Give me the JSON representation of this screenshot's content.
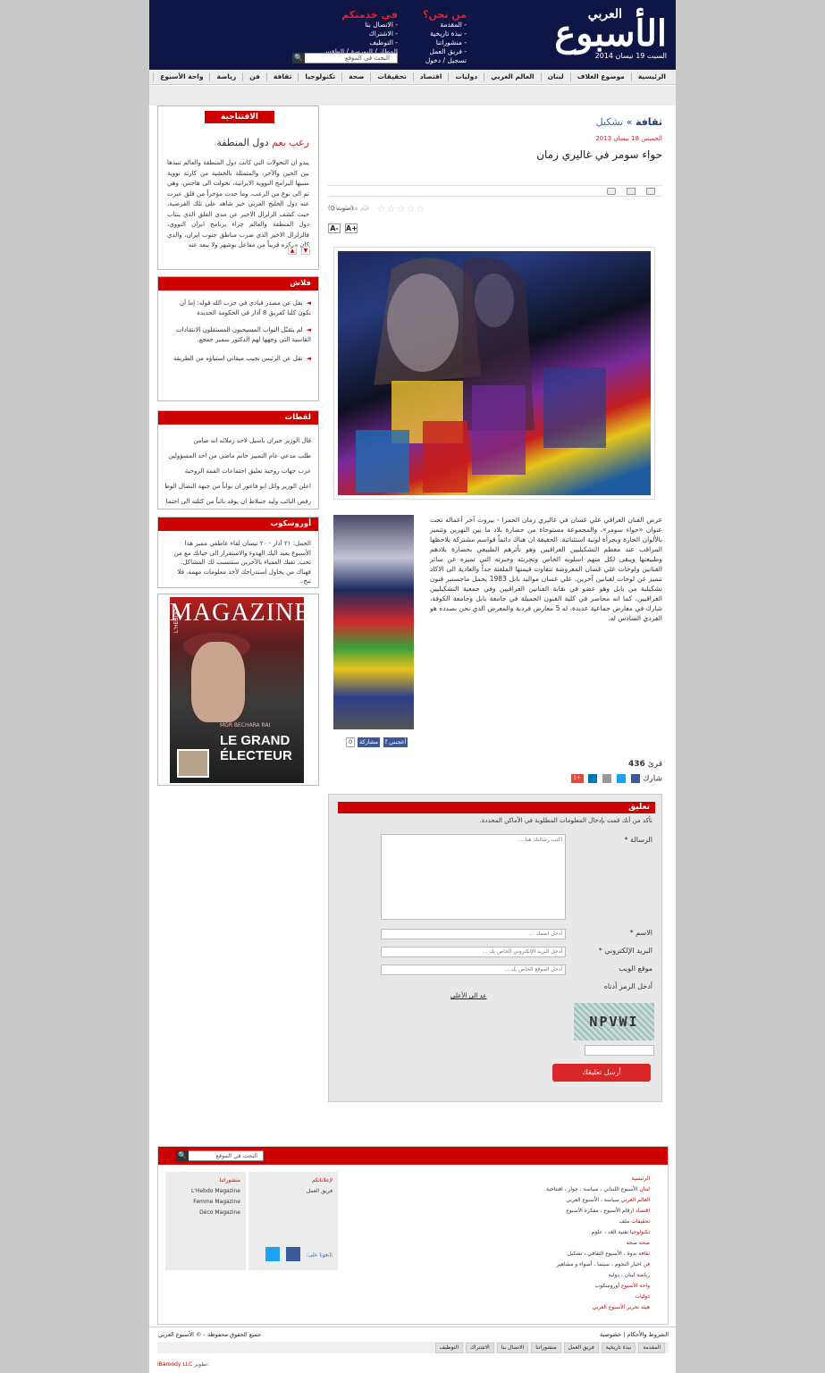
{
  "header": {
    "logo_main": "الأسبوع",
    "logo_sub": "العربي",
    "date": "السبت 19 نيسان 2014",
    "about": {
      "title": "من نحن؟",
      "links": [
        "- المقدمة",
        "- نبذة تاريخية",
        "- منشوراتنا",
        "- فريق العمل",
        "تسجيل / دخول"
      ]
    },
    "services": {
      "title": "في خدمتكم",
      "links": [
        "- الاتصال بنا",
        "- الاشتراك",
        "- التوظيف",
        "المطار / البورصة / الطقس"
      ]
    },
    "search_placeholder": "البحث في الموقع",
    "search_btn": "🔍"
  },
  "nav": [
    "الرئيسية",
    "موضوع الغلاف",
    "لبنان",
    "العالم العربي",
    "دوليات",
    "اقتصاد",
    "تحقيقات",
    "صحة",
    "تكنولوجيا",
    "ثقافة",
    "فن",
    "رياضة",
    "واحة الأسبوع"
  ],
  "article": {
    "section": "ثقافة",
    "subsection": "تشكيل",
    "date": "الخميس 18 نيسان 2013",
    "title": "حواء سومر في غاليري زمان",
    "rate_hint": "قيّم هذا المقال",
    "rate_count": "(صوت 0)",
    "stars": "☆☆☆☆☆",
    "font_plus": "A+",
    "font_minus": "A-",
    "body": "عرض الفنان العراقي علي غسان في غاليري زمان الحمرا - بيروت آخر أعماله تحت عنوان «حواء سومر»، والمجموعة مستوحاة من حضارة بلاد ما بين النهرين وتتميز بالألوان الحارة وبجرأة لونية استثنائية. الحقيقة ان هناك دائماً قواسم مشتركة يلاحظها المراقب عند معظم التشكيليين العراقيين وهو تأثرهم الطبيعي بحضارة بلادهم وطبيعتها ويبقى لكل منهم اسلوبه الخاص وتجربته وخبرته التي تميزه عن سائر الفنانين ولوحات علي غسان المعروضة تتفاوت قيمتها الملفتة جداً والعادية الى الاكاد تتميز عن لوحات لفنانين آخرين. علي غسان مواليد بابل 1983 يحمل ماجستير فنون تشكيلية من بابل وهو عضو في نقابة الفنانين العراقيين وفي جمعية التشكيليين العراقيين، كما انه محاضر في كلية الفنون الجميلة في جامعة بابل وجامعة الكوفة، شارك في معارض جماعية عديدة، له 5 معارض فردية والمعرض الذي نحن بصدده هو الفردي السادس له.",
    "fb_like": "أعجبني",
    "fb_share": "مشاركة",
    "fb_count": "0",
    "reads_label": "قرئ",
    "reads": "436",
    "share_label": "شارك",
    "gplus": "+1"
  },
  "comment": {
    "title": "تعليق",
    "note": "تأكد من أنك قمت بإدخال المعلومات المطلوبة في الأماكن المحددة.",
    "message_label": "الرسالة *",
    "message_placeholder": "اكتب رسالتك هنا ...",
    "name_label": "الاسم *",
    "name_placeholder": "أدخل اسمك ...",
    "email_label": "البريد الإلكتروني *",
    "email_placeholder": "أدخل البريد الإلكتروني الخاص بك ...",
    "site_label": "موقع الويب",
    "site_placeholder": "أدخل الموقع الخاص بك ...",
    "captcha_label": "أدخل الرمز أدناه",
    "captcha_text": "NPVWI",
    "send": "أرسل تعليقك",
    "to_top": "عد الى الأعلى"
  },
  "sidebar": {
    "editorial": {
      "title": "الافتتاحية",
      "headline_a": "رعب بعم",
      "headline_b": "دول المنطقة",
      "body": "يبدو ان التحولات التي كانت دول المنطقة والعالم تنبذها بين الحين والآخر، والمتمثلة بالخشية من كارثة نووية سببها البرامج النووية الايرانية، تحولت الى هاجس، وهي تم الى نوع من الرعب، وما حدث مؤخراً من قلق عبرت عنه دول الخليج العربي خير شاهد على تلك الفرضية، حيث كشف الزلزال الاخير عن مدى القلق الذي ينتاب دول المنطقة والعالم جراء برنامج ايران النووي، فالزلزال الاخير الذي ضرب مناطق جنوب ايران، والذي كان مركزه قريباً من مفاعل بوشهر ولا يبعد عنه",
      "up": "▲",
      "down": "▼"
    },
    "flash": {
      "title": "فلاش",
      "items": [
        "نقل عن مصدر قيادي في حزب الله قوله: إما أن نكون كلنا كفريق 8 آذار في الحكومة الجديدة",
        "لم يتقبّل النواب المسيحيون المستقلون الانتقادات القاسية التي وجهها لهم الدكتور سمير جعجع.",
        "نقل عن الرئيس نجيب ميقاتي استياؤه من الطريقة"
      ]
    },
    "snapshots": {
      "title": "لقطات",
      "items": [
        "قال الوزير جبران باسيل لاحد زملائه انه ضامن",
        "طلب مدعي عام التمييز حاتم ماضي من احد المسؤولين",
        "عرب جهات روحية تعليق اجتماعات القمة الروحية",
        "اعلن الوزير وائل ابو فاعور ان نواباً من جبهة النضال الوطني",
        "رفض النائب وليد جنبلاط ان يوقد نائباً من كتلته الى اجتماع"
      ]
    },
    "horoscope": {
      "title": "أوروسكوب",
      "body": "الحمل: ٢١ آذار - ٢٠ نيسان لقاء عاطفي مميز هذا الأسبوع يعيد اليك الهدوء والاستقرار الى حياتك مع من تحب. تفتك العمياء بالآخرين ستتسبب لك المشاكل. فهناك من يحاول استدراجك لأخذ معلومات مهمة. فلا تبح.."
    },
    "magazine": {
      "brand": "L'HEBDO",
      "title": "MAGAZINE",
      "cover": "LE GRAND ÉLECTEUR",
      "kicker": "MGR BECHARA RAI"
    }
  },
  "footer": {
    "search_placeholder": "البحث في الموقع",
    "search_btn": "🔍",
    "box_ads": {
      "title": "لإعلاناتكم",
      "items": [
        "فريق العمل"
      ]
    },
    "box_pubs": {
      "title": "منشوراتنا",
      "items": [
        "L'Hebdo Magazine",
        "Femme Magazine",
        "Déco Magazine"
      ]
    },
    "follow": "تابعونا على:",
    "sitemap": [
      {
        "head": "الرئيسية",
        "sub": ""
      },
      {
        "head": "لبنان",
        "sub": "الأسبوع اللبناني ، سياسة ، حوار ، افتتاحية"
      },
      {
        "head": "العالم العربي",
        "sub": "سياسة ، الأسبوع العربي"
      },
      {
        "head": "اقتصاد",
        "sub": "ارقام الأسبوع ، مفكرة الأسبوع"
      },
      {
        "head": "تحقيقات",
        "sub": "ملف"
      },
      {
        "head": "تكنولوجيا",
        "sub": "تقنية الغد ، علوم"
      },
      {
        "head": "صحة",
        "sub": "صحة"
      },
      {
        "head": "ثقافة",
        "sub": "ندوة ، الأسبوع الثقافي ، تشكيل"
      },
      {
        "head": "فن",
        "sub": "اخبار النجوم ، سينما ، أضواء و مشاهير"
      },
      {
        "head": "رياضة",
        "sub": "لبنان ، دولية"
      },
      {
        "head": "واحة الأسبوع",
        "sub": "أوروسكوب"
      },
      {
        "head": "دوليات",
        "sub": ""
      },
      {
        "head": "هيئة تحرير الأسبوع العربي",
        "sub": ""
      }
    ]
  },
  "bottom": {
    "copyright": "جميع الحقوق محفوظة - © الأسبوع العربي",
    "terms": "الشروط والأحكام | خصوصية",
    "links": [
      "المقدمة",
      "نبذة تاريخية",
      "فريق العمل",
      "منشوراتنا",
      "الاتصال بنا",
      "الاشتراك",
      "التوظيف"
    ],
    "credit_label": "تطوير:",
    "credit": "iBaroody LLC"
  }
}
